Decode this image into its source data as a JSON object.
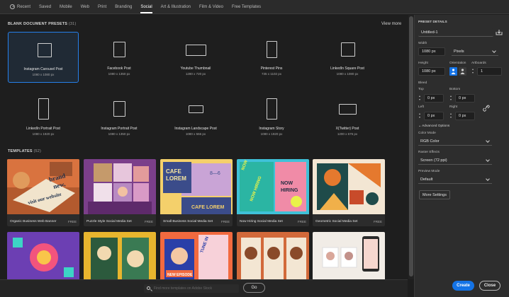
{
  "tabs": [
    {
      "label": "Recent",
      "icon": "clock-icon"
    },
    {
      "label": "Saved"
    },
    {
      "label": "Mobile"
    },
    {
      "label": "Web"
    },
    {
      "label": "Print"
    },
    {
      "label": "Branding"
    },
    {
      "label": "Social",
      "active": true
    },
    {
      "label": "Art & Illustration"
    },
    {
      "label": "Film & Video"
    },
    {
      "label": "Free Templates"
    }
  ],
  "presets_section": {
    "title": "BLANK DOCUMENT PRESETS",
    "count": "(31)",
    "view_more": "View more"
  },
  "presets": [
    {
      "name": "Instagram Carousel Post",
      "size": "1080 x 1080 px",
      "selected": true
    },
    {
      "name": "Facebook Post",
      "size": "1080 x 1350 px"
    },
    {
      "name": "Youtube Thumbnail",
      "size": "1280 x 720 px"
    },
    {
      "name": "Pinterest Pins",
      "size": "735 x 1102 px"
    },
    {
      "name": "LinkedIn Square Post",
      "size": "1080 x 1080 px"
    },
    {
      "name": "LinkedIn Portrait Post",
      "size": "1080 x 1920 px"
    },
    {
      "name": "Instagram Portrait Post",
      "size": "1080 x 1350 px"
    },
    {
      "name": "Instagram Landscape Post",
      "size": "1080 x 566 px"
    },
    {
      "name": "Instagram Story",
      "size": "1080 x 1920 px"
    },
    {
      "name": "X(Twitter) Post",
      "size": "1200 x 675 px"
    }
  ],
  "templates_section": {
    "title": "TEMPLATES",
    "count": "(52)"
  },
  "templates": [
    {
      "name": "Organic Business Web Banner",
      "badge": "FREE",
      "thumb_text": "brand new, visit our website"
    },
    {
      "name": "Puzzle Style Social Media Set",
      "badge": "FREE"
    },
    {
      "name": "Small Business Social Media Set",
      "badge": "FREE",
      "thumb_text": "CAFE LOREM"
    },
    {
      "name": "Now Hiring Social Media Set",
      "badge": "FREE",
      "thumb_text": "NOW HIRING"
    },
    {
      "name": "Geometric Social Media Set",
      "badge": "FREE"
    }
  ],
  "bottom_templates": [
    {
      "thumb_text": ""
    },
    {
      "thumb_text": ""
    },
    {
      "thumb_text": "NEW EPISODE"
    },
    {
      "thumb_text": ""
    },
    {
      "thumb_text": ""
    }
  ],
  "search": {
    "placeholder": "Find more templates on Adobe Stock",
    "go_label": "Go"
  },
  "panel": {
    "header": "PRESET DETAILS",
    "doc_name": "Untitled-1",
    "width_label": "Width",
    "width_value": "1080 px",
    "units": "Pixels",
    "height_label": "Height",
    "height_value": "1080 px",
    "orientation_label": "Orientation",
    "artboards_label": "Artboards",
    "artboards_value": "1",
    "bleed_label": "Bleed",
    "top_label": "Top",
    "top_value": "0 px",
    "bottom_label": "Bottom",
    "bottom_value": "0 px",
    "left_label": "Left",
    "left_value": "0 px",
    "right_label": "Right",
    "right_value": "0 px",
    "advanced_label": "Advanced Options",
    "color_mode_label": "Color Mode",
    "color_mode_value": "RGB Color",
    "raster_label": "Raster Effects",
    "raster_value": "Screen (72 ppi)",
    "preview_label": "Preview Mode",
    "preview_value": "Default",
    "more_settings": "More Settings"
  },
  "actions": {
    "create": "Create",
    "close": "Close"
  },
  "colors": {
    "accent": "#1473e6",
    "selected_border": "#2680eb",
    "background": "#1e1e1e",
    "panel": "#2d2d2d"
  }
}
